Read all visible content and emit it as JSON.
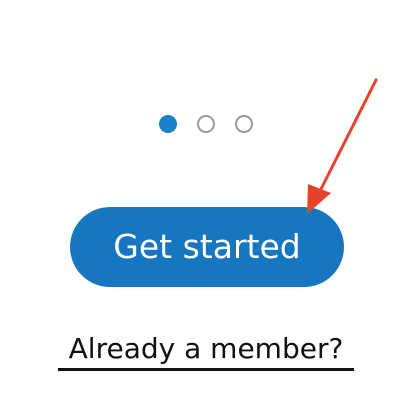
{
  "onboarding": {
    "pager": {
      "total_pages": 3,
      "current_page": 1,
      "active_color": "#1a82c8",
      "inactive_color": "#9b9b9b"
    },
    "cta_label": "Get started",
    "cta_color": "#1776c0",
    "login_link_label": "Already a member?"
  },
  "annotation": {
    "icon": "arrow-icon",
    "color": "#e8412c"
  }
}
